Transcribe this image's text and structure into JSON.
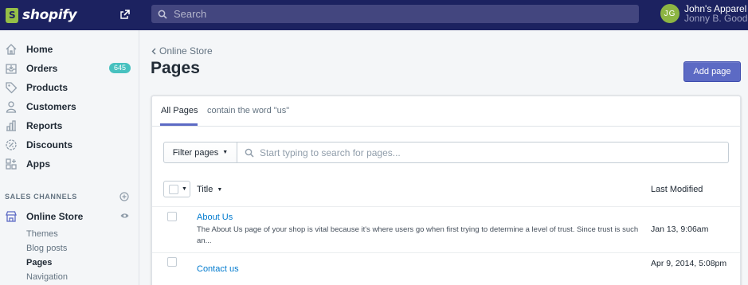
{
  "topbar": {
    "brand": "shopify",
    "search_placeholder": "Search",
    "avatar_initials": "JG",
    "store_name": "John's Apparel",
    "user_name": "Jonny B. Good"
  },
  "sidebar": {
    "items": [
      {
        "label": "Home",
        "icon": "home-icon"
      },
      {
        "label": "Orders",
        "icon": "orders-icon",
        "badge": "645"
      },
      {
        "label": "Products",
        "icon": "tag-icon"
      },
      {
        "label": "Customers",
        "icon": "person-icon"
      },
      {
        "label": "Reports",
        "icon": "bar-chart-icon"
      },
      {
        "label": "Discounts",
        "icon": "discount-icon"
      },
      {
        "label": "Apps",
        "icon": "apps-icon"
      }
    ],
    "section_title": "SALES CHANNELS",
    "channel": {
      "label": "Online Store",
      "icon": "store-icon"
    },
    "sub_items": [
      "Themes",
      "Blog posts",
      "Pages",
      "Navigation"
    ],
    "active_sub": "Pages"
  },
  "main": {
    "breadcrumb": "Online Store",
    "title": "Pages",
    "add_button": "Add page",
    "tabs": [
      "All Pages",
      "contain the word \"us\""
    ],
    "filter_button": "Filter pages",
    "filter_placeholder": "Start typing to search for pages...",
    "columns": {
      "title": "Title",
      "modified": "Last Modified"
    },
    "rows": [
      {
        "title": "About Us",
        "description": "The About Us page of your shop is vital because it's where users go when first trying to determine a level of trust. Since trust is such an...",
        "date": "Jan 13, 9:06am"
      },
      {
        "title": "Contact us",
        "description": "",
        "date": "Apr 9, 2014, 5:08pm"
      }
    ]
  },
  "colors": {
    "topbar": "#1c2260",
    "accent": "#5c6ac4",
    "link": "#007ace",
    "badge": "#47c1bf"
  }
}
